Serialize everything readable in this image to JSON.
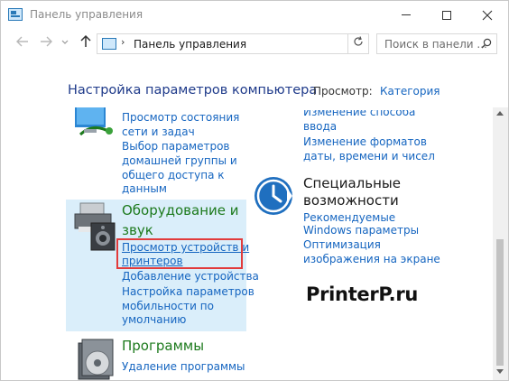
{
  "window": {
    "title": "Панель управления"
  },
  "address_bar": {
    "breadcrumb": "Панель управления",
    "separator": "›"
  },
  "search": {
    "placeholder": "Поиск в панели ..."
  },
  "header": {
    "title": "Настройка параметров компьютера",
    "view_label": "Просмотр:",
    "view_value": "Категория"
  },
  "network": {
    "links": [
      "Просмотр состояния",
      "сети и задач",
      "Выбор параметров",
      "домашней группы и",
      "общего доступа к",
      "данным"
    ]
  },
  "clock_region": {
    "links": [
      "Изменение способа",
      "ввода",
      "Изменение форматов",
      "даты, времени и чисел"
    ]
  },
  "hardware": {
    "title_lines": [
      "Оборудование и",
      "звук"
    ],
    "links": [
      "Просмотр устройств и",
      "принтеров",
      "Добавление устройства",
      "Настройка параметров",
      "мобильности по",
      "умолчанию"
    ]
  },
  "accessibility": {
    "title_lines": [
      "Специальные",
      "возможности"
    ],
    "links": [
      "Рекомендуемые",
      "Windows параметры",
      "Оптимизация",
      "изображения на экране"
    ]
  },
  "programs": {
    "title": "Программы",
    "links": [
      "Удаление программы"
    ]
  },
  "watermark": "PrinterP.ru",
  "colors": {
    "link": "#1565c0",
    "category_title": "#1d7a1d",
    "highlight": "#e23b3b",
    "selected_bg": "#daeefa"
  }
}
